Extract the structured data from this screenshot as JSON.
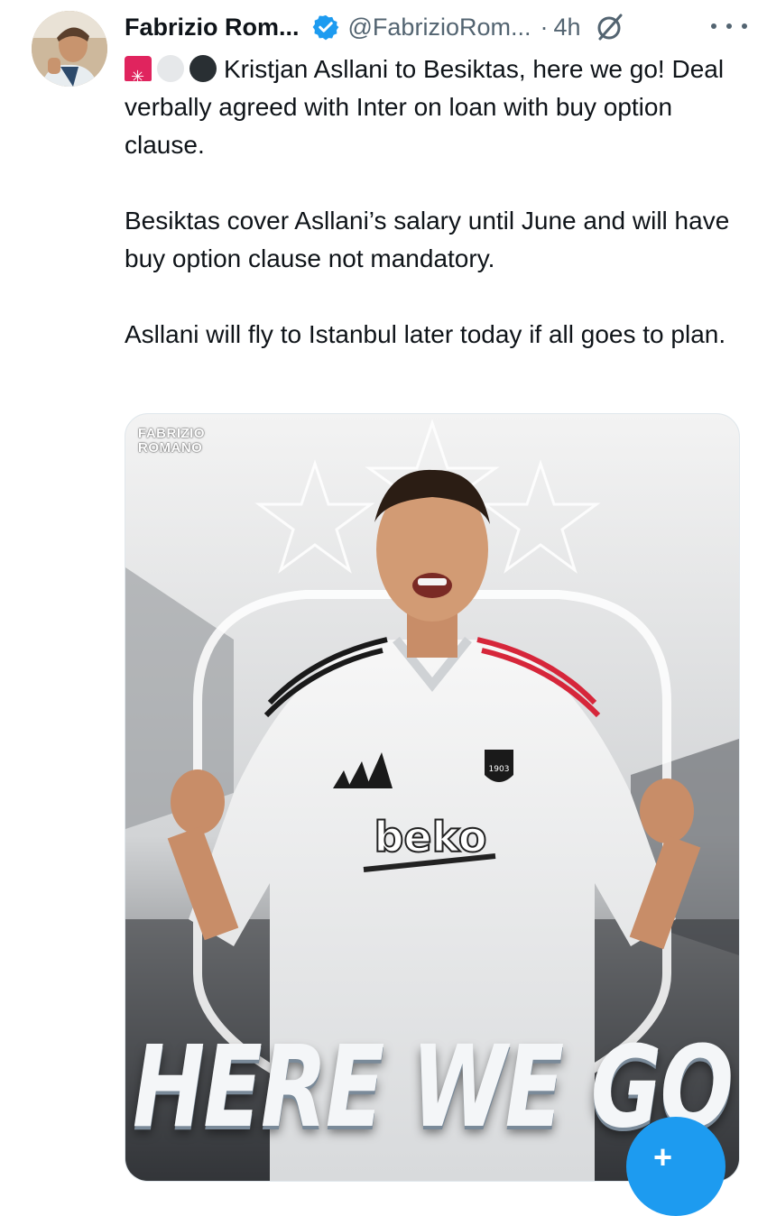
{
  "author": {
    "name": "Fabrizio Rom...",
    "handle": "@FabrizioRom...",
    "separator": "·",
    "time": "4h"
  },
  "tweet": {
    "lines": [
      "Kristjan Asllani to Besiktas, here we go! Deal verbally agreed with Inter on loan with buy option clause.",
      "Besiktas cover Asllani’s salary until June and will have buy option clause not mandatory.",
      "Asllani will fly to Istanbul later today if all goes to plan."
    ]
  },
  "media": {
    "watermark_line1": "FABRIZIO",
    "watermark_line2": "ROMANO",
    "headline": "HERE WE GO",
    "sponsor": "beko",
    "badge_year": "1903"
  },
  "colors": {
    "accent": "#1d9bf0",
    "text": "#0f1419",
    "muted": "#536471"
  },
  "icons": {
    "verified": "verified-badge-icon",
    "grok": "grok-icon",
    "more": "more-options-icon",
    "compose": "compose-icon"
  },
  "compose_label": "+"
}
